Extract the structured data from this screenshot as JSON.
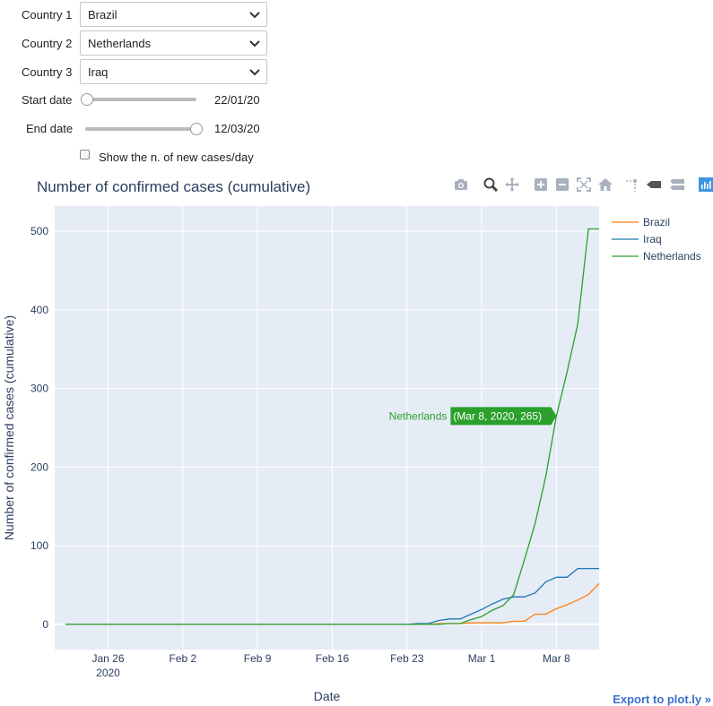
{
  "controls": {
    "country1": {
      "label": "Country 1",
      "value": "Brazil"
    },
    "country2": {
      "label": "Country 2",
      "value": "Netherlands"
    },
    "country3": {
      "label": "Country 3",
      "value": "Iraq"
    },
    "start_date": {
      "label": "Start date",
      "value": "22/01/20",
      "position": 0.0
    },
    "end_date": {
      "label": "End date",
      "value": "12/03/20",
      "position": 1.0
    },
    "new_cases_checkbox": {
      "label": "Show the n. of new cases/day",
      "checked": false
    }
  },
  "modebar": {
    "icons": [
      "camera-icon",
      "zoom-icon",
      "pan-icon",
      "zoom-in-icon",
      "zoom-out-icon",
      "autoscale-icon",
      "reset-axes-icon",
      "spike-lines-icon",
      "hover-closest-icon",
      "hover-compare-icon",
      "plotly-logo-icon"
    ]
  },
  "export_link": "Export to plot.ly »",
  "chart_data": {
    "type": "line",
    "title": "Number of confirmed cases (cumulative)",
    "xlabel": "Date",
    "ylabel": "Number of confirmed cases (cumulative)",
    "xlim": [
      "2020-01-21",
      "2020-03-12"
    ],
    "ylim": [
      -32,
      532
    ],
    "xticks": [
      {
        "date": "2020-01-26",
        "label": "Jan 26",
        "sublabel": "2020"
      },
      {
        "date": "2020-02-02",
        "label": "Feb 2",
        "sublabel": ""
      },
      {
        "date": "2020-02-09",
        "label": "Feb 9",
        "sublabel": ""
      },
      {
        "date": "2020-02-16",
        "label": "Feb 16",
        "sublabel": ""
      },
      {
        "date": "2020-02-23",
        "label": "Feb 23",
        "sublabel": ""
      },
      {
        "date": "2020-03-01",
        "label": "Mar 1",
        "sublabel": ""
      },
      {
        "date": "2020-03-08",
        "label": "Mar 8",
        "sublabel": ""
      }
    ],
    "yticks": [
      0,
      100,
      200,
      300,
      400,
      500
    ],
    "grid": true,
    "legend_position": "right",
    "series": [
      {
        "name": "Brazil",
        "color": "#ff7f0e",
        "x": [
          "2020-01-22",
          "2020-02-25",
          "2020-02-26",
          "2020-02-27",
          "2020-02-28",
          "2020-02-29",
          "2020-03-01",
          "2020-03-02",
          "2020-03-03",
          "2020-03-04",
          "2020-03-05",
          "2020-03-06",
          "2020-03-07",
          "2020-03-08",
          "2020-03-09",
          "2020-03-10",
          "2020-03-11",
          "2020-03-12"
        ],
        "y": [
          0,
          0,
          1,
          1,
          1,
          2,
          2,
          2,
          2,
          4,
          4,
          13,
          13,
          20,
          25,
          31,
          38,
          52
        ]
      },
      {
        "name": "Iraq",
        "color": "#1f77b4",
        "x": [
          "2020-01-22",
          "2020-02-23",
          "2020-02-24",
          "2020-02-25",
          "2020-02-26",
          "2020-02-27",
          "2020-02-28",
          "2020-02-29",
          "2020-03-01",
          "2020-03-02",
          "2020-03-03",
          "2020-03-04",
          "2020-03-05",
          "2020-03-06",
          "2020-03-07",
          "2020-03-08",
          "2020-03-09",
          "2020-03-10",
          "2020-03-11",
          "2020-03-12"
        ],
        "y": [
          0,
          0,
          1,
          1,
          5,
          7,
          7,
          13,
          19,
          26,
          32,
          35,
          35,
          40,
          54,
          60,
          60,
          71,
          71,
          71
        ]
      },
      {
        "name": "Netherlands",
        "color": "#2ca02c",
        "x": [
          "2020-01-22",
          "2020-02-26",
          "2020-02-27",
          "2020-02-28",
          "2020-02-29",
          "2020-03-01",
          "2020-03-02",
          "2020-03-03",
          "2020-03-04",
          "2020-03-05",
          "2020-03-06",
          "2020-03-07",
          "2020-03-08",
          "2020-03-09",
          "2020-03-10",
          "2020-03-11",
          "2020-03-12"
        ],
        "y": [
          0,
          0,
          1,
          1,
          6,
          10,
          18,
          24,
          38,
          82,
          128,
          188,
          265,
          321,
          382,
          503,
          503
        ]
      }
    ],
    "hover": {
      "series": "Netherlands",
      "label": "Netherlands",
      "text": "(Mar 8, 2020, 265)",
      "date": "2020-03-08",
      "value": 265
    }
  }
}
